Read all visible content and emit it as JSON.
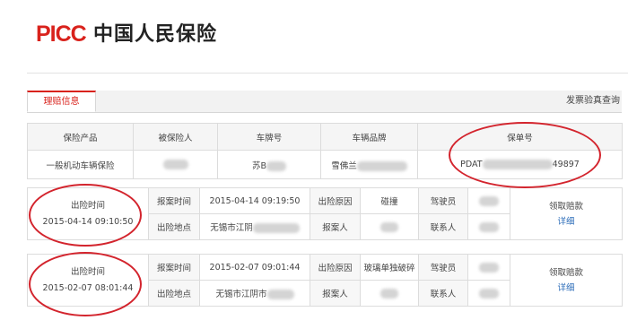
{
  "header": {
    "logo_text": "PICC",
    "company_name": "中国人民保险"
  },
  "tabs": {
    "active": "理赔信息",
    "right_link": "发票验真查询"
  },
  "policy": {
    "headers": [
      "保险产品",
      "被保险人",
      "车牌号",
      "车辆品牌",
      "保单号"
    ],
    "row": {
      "product": "一般机动车辆保险",
      "plate_prefix": "苏B",
      "brand_prefix": "雪佛兰",
      "policy_prefix": "PDAT",
      "policy_suffix": "49897"
    }
  },
  "claims": [
    {
      "accident_time_label": "出险时间",
      "accident_time": "2015-04-14 09:10:50",
      "report_time_label": "报案时间",
      "report_time": "2015-04-14 09:19:50",
      "cause_label": "出险原因",
      "cause": "碰撞",
      "driver_label": "驾驶员",
      "place_label": "出险地点",
      "place_prefix": "无锡市江阴",
      "reporter_label": "报案人",
      "contact_label": "联系人",
      "action_label": "领取赔款",
      "detail_label": "详细"
    },
    {
      "accident_time_label": "出险时间",
      "accident_time": "2015-02-07 08:01:44",
      "report_time_label": "报案时间",
      "report_time": "2015-02-07 09:01:44",
      "cause_label": "出险原因",
      "cause": "玻璃单独破碎",
      "driver_label": "驾驶员",
      "place_label": "出险地点",
      "place_prefix": "无锡市江阴市",
      "reporter_label": "报案人",
      "contact_label": "联系人",
      "action_label": "领取赔款",
      "detail_label": "详细"
    }
  ],
  "colors": {
    "brand_red": "#d9221c",
    "annotation_red": "#d3242d",
    "link_blue": "#2a6bb8"
  }
}
